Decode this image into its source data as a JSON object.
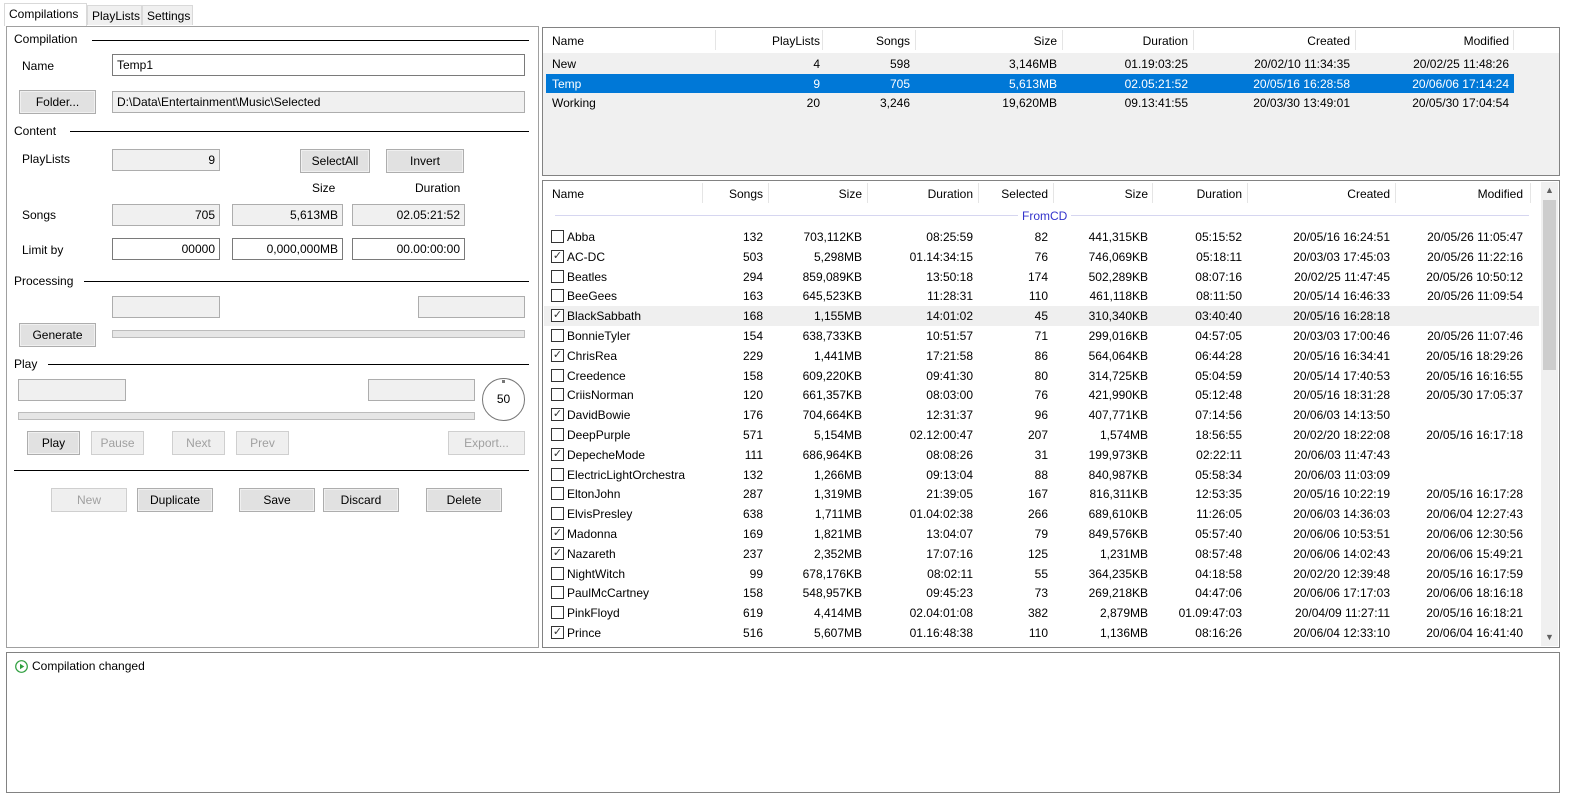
{
  "tabs": [
    {
      "label": "Compilations",
      "active": true
    },
    {
      "label": "PlayLists"
    },
    {
      "label": "Settings"
    }
  ],
  "left": {
    "compilation": {
      "group": "Compilation",
      "name_label": "Name",
      "name_value": "Temp1",
      "folder_button": "Folder...",
      "folder_value": "D:\\Data\\Entertainment\\Music\\Selected"
    },
    "content": {
      "group": "Content",
      "playlists_label": "PlayLists",
      "playlists_value": "9",
      "select_all": "SelectAll",
      "invert": "Invert",
      "size_header": "Size",
      "duration_header": "Duration",
      "songs_label": "Songs",
      "songs_value": "705",
      "songs_size": "5,613MB",
      "songs_duration": "02.05:21:52",
      "limit_label": "Limit by",
      "limit_songs": "00000",
      "limit_size": "0,000,000MB",
      "limit_duration": "00.00:00:00"
    },
    "processing": {
      "group": "Processing",
      "generate": "Generate",
      "progress": 0
    },
    "play": {
      "group": "Play",
      "progress": 0,
      "volume": "50",
      "play": "Play",
      "pause": "Pause",
      "next": "Next",
      "prev": "Prev",
      "export": "Export..."
    },
    "actions": {
      "new": "New",
      "duplicate": "Duplicate",
      "save": "Save",
      "discard": "Discard",
      "delete": "Delete"
    }
  },
  "compilations_table": {
    "columns": [
      "Name",
      "PlayLists",
      "Songs",
      "Size",
      "Duration",
      "Created",
      "Modified"
    ],
    "rows": [
      [
        "New",
        "4",
        "598",
        "3,146MB",
        "01.19:03:25",
        "20/02/10 11:34:35",
        "20/02/25 11:48:26"
      ],
      [
        "Temp",
        "9",
        "705",
        "5,613MB",
        "02.05:21:52",
        "20/05/16 16:28:58",
        "20/06/06 17:14:24"
      ],
      [
        "Working",
        "20",
        "3,246",
        "19,620MB",
        "09.13:41:55",
        "20/03/30 13:49:01",
        "20/05/30 17:04:54"
      ]
    ],
    "selected_index": 1,
    "selection_color": "#0078d7"
  },
  "playlists_table": {
    "columns": [
      "Name",
      "Songs",
      "Size",
      "Duration",
      "Selected",
      "Size",
      "Duration",
      "Created",
      "Modified"
    ],
    "group_label": "FromCD",
    "group_color": "#3333cc",
    "hover_index": 4,
    "rows": [
      {
        "checked": false,
        "cells": [
          "Abba",
          "132",
          "703,112KB",
          "08:25:59",
          "82",
          "441,315KB",
          "05:15:52",
          "20/05/16 16:24:51",
          "20/05/26 11:05:47"
        ]
      },
      {
        "checked": true,
        "cells": [
          "AC-DC",
          "503",
          "5,298MB",
          "01.14:34:15",
          "76",
          "746,069KB",
          "05:18:11",
          "20/03/03 17:45:03",
          "20/05/26 11:22:16"
        ]
      },
      {
        "checked": false,
        "cells": [
          "Beatles",
          "294",
          "859,089KB",
          "13:50:18",
          "174",
          "502,289KB",
          "08:07:16",
          "20/02/25 11:47:45",
          "20/05/26 10:50:12"
        ]
      },
      {
        "checked": false,
        "cells": [
          "BeeGees",
          "163",
          "645,523KB",
          "11:28:31",
          "110",
          "461,118KB",
          "08:11:50",
          "20/05/14 16:46:33",
          "20/05/26 11:09:54"
        ]
      },
      {
        "checked": true,
        "cells": [
          "BlackSabbath",
          "168",
          "1,155MB",
          "14:01:02",
          "45",
          "310,340KB",
          "03:40:40",
          "20/05/16 16:28:18",
          ""
        ]
      },
      {
        "checked": false,
        "cells": [
          "BonnieTyler",
          "154",
          "638,733KB",
          "10:51:57",
          "71",
          "299,016KB",
          "04:57:05",
          "20/03/03 17:00:46",
          "20/05/26 11:07:46"
        ]
      },
      {
        "checked": true,
        "cells": [
          "ChrisRea",
          "229",
          "1,441MB",
          "17:21:58",
          "86",
          "564,064KB",
          "06:44:28",
          "20/05/16 16:34:41",
          "20/05/16 18:29:26"
        ]
      },
      {
        "checked": false,
        "cells": [
          "Creedence",
          "158",
          "609,220KB",
          "09:41:30",
          "80",
          "314,725KB",
          "05:04:59",
          "20/05/14 17:40:53",
          "20/05/16 16:16:55"
        ]
      },
      {
        "checked": false,
        "cells": [
          "CriisNorman",
          "120",
          "661,357KB",
          "08:03:00",
          "76",
          "421,990KB",
          "05:12:48",
          "20/05/16 18:31:28",
          "20/05/30 17:05:37"
        ]
      },
      {
        "checked": true,
        "cells": [
          "DavidBowie",
          "176",
          "704,664KB",
          "12:31:37",
          "96",
          "407,771KB",
          "07:14:56",
          "20/06/03 14:13:50",
          ""
        ]
      },
      {
        "checked": false,
        "cells": [
          "DeepPurple",
          "571",
          "5,154MB",
          "02.12:00:47",
          "207",
          "1,574MB",
          "18:56:55",
          "20/02/20 18:22:08",
          "20/05/16 16:17:18"
        ]
      },
      {
        "checked": true,
        "cells": [
          "DepecheMode",
          "111",
          "686,964KB",
          "08:08:26",
          "31",
          "199,973KB",
          "02:22:11",
          "20/06/03 11:47:43",
          ""
        ]
      },
      {
        "checked": false,
        "cells": [
          "ElectricLightOrchestra",
          "132",
          "1,266MB",
          "09:13:04",
          "88",
          "840,987KB",
          "05:58:34",
          "20/06/03 11:03:09",
          ""
        ]
      },
      {
        "checked": false,
        "cells": [
          "EltonJohn",
          "287",
          "1,319MB",
          "21:39:05",
          "167",
          "816,311KB",
          "12:53:35",
          "20/05/16 10:22:19",
          "20/05/16 16:17:28"
        ]
      },
      {
        "checked": false,
        "cells": [
          "ElvisPresley",
          "638",
          "1,711MB",
          "01.04:02:38",
          "266",
          "689,610KB",
          "11:26:05",
          "20/06/03 14:36:03",
          "20/06/04 12:27:43"
        ]
      },
      {
        "checked": true,
        "cells": [
          "Madonna",
          "169",
          "1,821MB",
          "13:04:07",
          "79",
          "849,576KB",
          "05:57:40",
          "20/06/06 10:53:51",
          "20/06/06 12:30:56"
        ]
      },
      {
        "checked": true,
        "cells": [
          "Nazareth",
          "237",
          "2,352MB",
          "17:07:16",
          "125",
          "1,231MB",
          "08:57:48",
          "20/06/06 14:02:43",
          "20/06/06 15:49:21"
        ]
      },
      {
        "checked": false,
        "cells": [
          "NightWitch",
          "99",
          "678,176KB",
          "08:02:11",
          "55",
          "364,235KB",
          "04:18:58",
          "20/02/20 12:39:48",
          "20/05/16 16:17:59"
        ]
      },
      {
        "checked": false,
        "cells": [
          "PaulMcCartney",
          "158",
          "548,957KB",
          "09:45:23",
          "73",
          "269,218KB",
          "04:47:06",
          "20/06/06 17:17:03",
          "20/06/06 18:16:18"
        ]
      },
      {
        "checked": false,
        "cells": [
          "PinkFloyd",
          "619",
          "4,414MB",
          "02.04:01:08",
          "382",
          "2,879MB",
          "01.09:47:03",
          "20/04/09 11:27:11",
          "20/05/16 16:18:21"
        ]
      },
      {
        "checked": true,
        "cells": [
          "Prince",
          "516",
          "5,607MB",
          "01.16:48:38",
          "110",
          "1,136MB",
          "08:16:26",
          "20/06/04 12:33:10",
          "20/06/04 16:41:40"
        ]
      }
    ]
  },
  "log": {
    "icon": "play-circle-icon",
    "icon_color": "#2e9e3e",
    "messages": [
      "Compilation changed"
    ]
  }
}
